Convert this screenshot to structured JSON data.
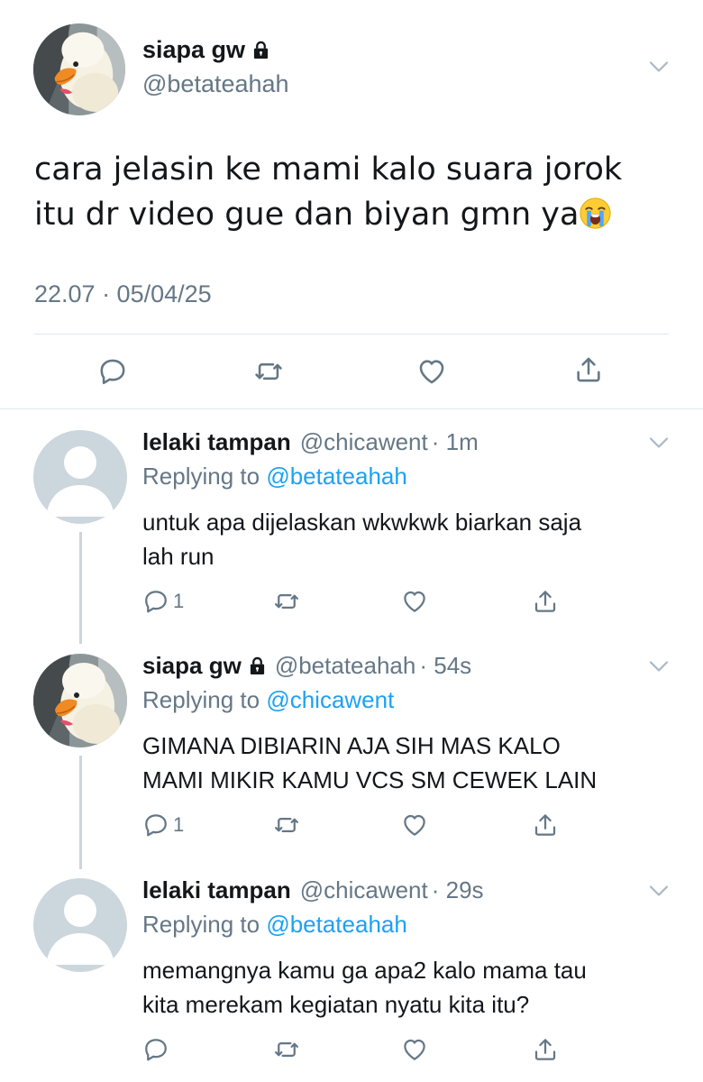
{
  "main_tweet": {
    "display_name": "siapa gw",
    "handle": "@betateahah",
    "text_line1": "cara jelasin ke mami kalo suara jorok",
    "text_line2": "itu dr video gue dan biyan gmn ya",
    "emoji": "😭",
    "timestamp": "22.07 · 05/04/25"
  },
  "replies": [
    {
      "display_name": "lelaki tampan",
      "handle": "@chicawent",
      "time": "· 1m",
      "replying_prefix": "Replying to",
      "replying_to": "@betateahah",
      "text_line1": "untuk apa dijelaskan wkwkwk biarkan saja",
      "text_line2": "lah run",
      "reply_count": "1"
    },
    {
      "display_name": "siapa gw",
      "handle": "@betateahah",
      "time": "· 54s",
      "replying_prefix": "Replying to",
      "replying_to": "@chicawent",
      "text_line1": "GIMANA DIBIARIN AJA SIH MAS KALO",
      "text_line2": "MAMI MIKIR KAMU VCS SM CEWEK LAIN",
      "reply_count": "1"
    },
    {
      "display_name": "lelaki tampan",
      "handle": "@chicawent",
      "time": "· 29s",
      "replying_prefix": "Replying to",
      "replying_to": "@betateahah",
      "text_line1": "memangnya kamu ga apa2 kalo mama tau",
      "text_line2": "kita merekam kegiatan nyatu kita itu?",
      "reply_count": ""
    }
  ],
  "colors": {
    "text": "#14171a",
    "secondary": "#657786",
    "accent": "#1da1f2",
    "divider": "#e1e8ed",
    "placeholder_avatar": "#ccd6dd"
  },
  "icons": {
    "reply": "reply-icon",
    "retweet": "retweet-icon",
    "like": "like-icon",
    "share": "share-icon",
    "menu": "chevron-down-icon",
    "protected": "lock-icon"
  }
}
